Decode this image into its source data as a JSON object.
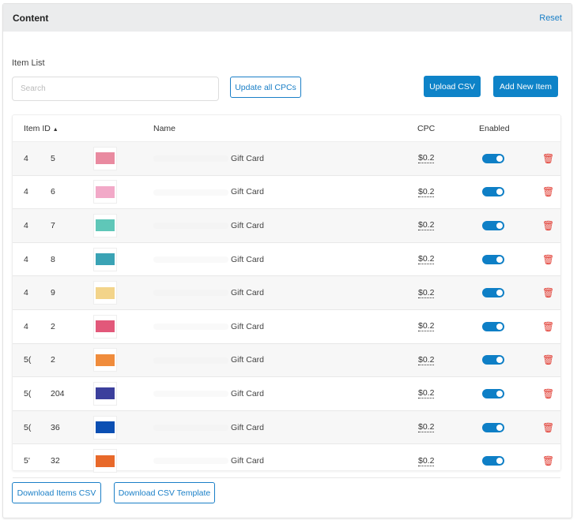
{
  "header": {
    "title": "Content",
    "reset": "Reset"
  },
  "item_list_label": "Item List",
  "search": {
    "placeholder": "Search",
    "value": ""
  },
  "buttons": {
    "update_cpcs": "Update all CPCs",
    "upload_csv": "Upload CSV",
    "add_item": "Add New Item",
    "download_items": "Download Items CSV",
    "download_template": "Download CSV Template"
  },
  "columns": {
    "id": "Item ID",
    "sort_icon": "▲",
    "name": "Name",
    "cpc": "CPC",
    "enabled": "Enabled"
  },
  "rows": [
    {
      "id_a": "4",
      "id_b": "5",
      "name": "Gift Card",
      "cpc": "$0.2",
      "enabled": true,
      "thumb": "#e98aa0"
    },
    {
      "id_a": "4",
      "id_b": "6",
      "name": "Gift Card",
      "cpc": "$0.2",
      "enabled": true,
      "thumb": "#f2a9c8"
    },
    {
      "id_a": "4",
      "id_b": "7",
      "name": "Gift Card",
      "cpc": "$0.2",
      "enabled": true,
      "thumb": "#5fc7b8"
    },
    {
      "id_a": "4",
      "id_b": "8",
      "name": "Gift Card",
      "cpc": "$0.2",
      "enabled": true,
      "thumb": "#3aa3b5"
    },
    {
      "id_a": "4",
      "id_b": "9",
      "name": "Gift Card",
      "cpc": "$0.2",
      "enabled": true,
      "thumb": "#f3d48a"
    },
    {
      "id_a": "4",
      "id_b": "2",
      "name": "Gift Card",
      "cpc": "$0.2",
      "enabled": true,
      "thumb": "#e2587a"
    },
    {
      "id_a": "5(",
      "id_b": "2",
      "name": "Gift Card",
      "cpc": "$0.2",
      "enabled": true,
      "thumb": "#f08c3c"
    },
    {
      "id_a": "5(",
      "id_b": "204",
      "name": "Gift Card",
      "cpc": "$0.2",
      "enabled": true,
      "thumb": "#3b3f9c"
    },
    {
      "id_a": "5(",
      "id_b": "36",
      "name": "Gift Card",
      "cpc": "$0.2",
      "enabled": true,
      "thumb": "#0b4fb3"
    },
    {
      "id_a": "5'",
      "id_b": "32",
      "name": "Gift Card",
      "cpc": "$0.2",
      "enabled": true,
      "thumb": "#e8692a"
    }
  ]
}
